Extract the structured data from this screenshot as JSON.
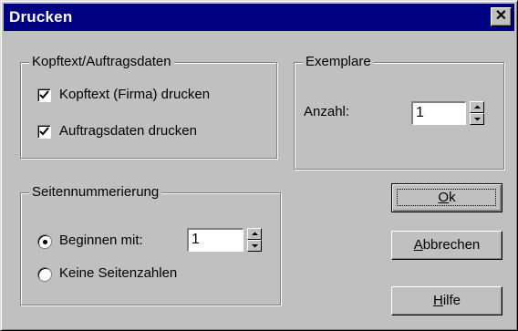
{
  "window": {
    "title": "Drucken",
    "close_symbol": "✕"
  },
  "kopftext_group": {
    "legend": "Kopftext/Auftragsdaten",
    "options": [
      {
        "label": "Kopftext (Firma) drucken",
        "checked": true
      },
      {
        "label": "Auftragsdaten drucken",
        "checked": true
      }
    ]
  },
  "exemplare_group": {
    "legend": "Exemplare",
    "count_label": "Anzahl:",
    "count_value": "1"
  },
  "seiten_group": {
    "legend": "Seitennummerierung",
    "options": [
      {
        "label": "Beginnen mit:",
        "selected": true
      },
      {
        "label": "Keine Seitenzahlen",
        "selected": false
      }
    ],
    "start_value": "1"
  },
  "buttons": {
    "ok": {
      "label": "Ok",
      "mnemonic": "O",
      "rest": "k"
    },
    "cancel": {
      "label": "Abbrechen",
      "mnemonic": "A",
      "rest": "bbrechen"
    },
    "help": {
      "label": "Hilfe",
      "mnemonic": "H",
      "rest": "ilfe"
    }
  },
  "icons": {
    "checkmark": "checkmark-icon",
    "spin_up": "arrow-up-icon",
    "spin_down": "arrow-down-icon",
    "close": "close-icon"
  }
}
